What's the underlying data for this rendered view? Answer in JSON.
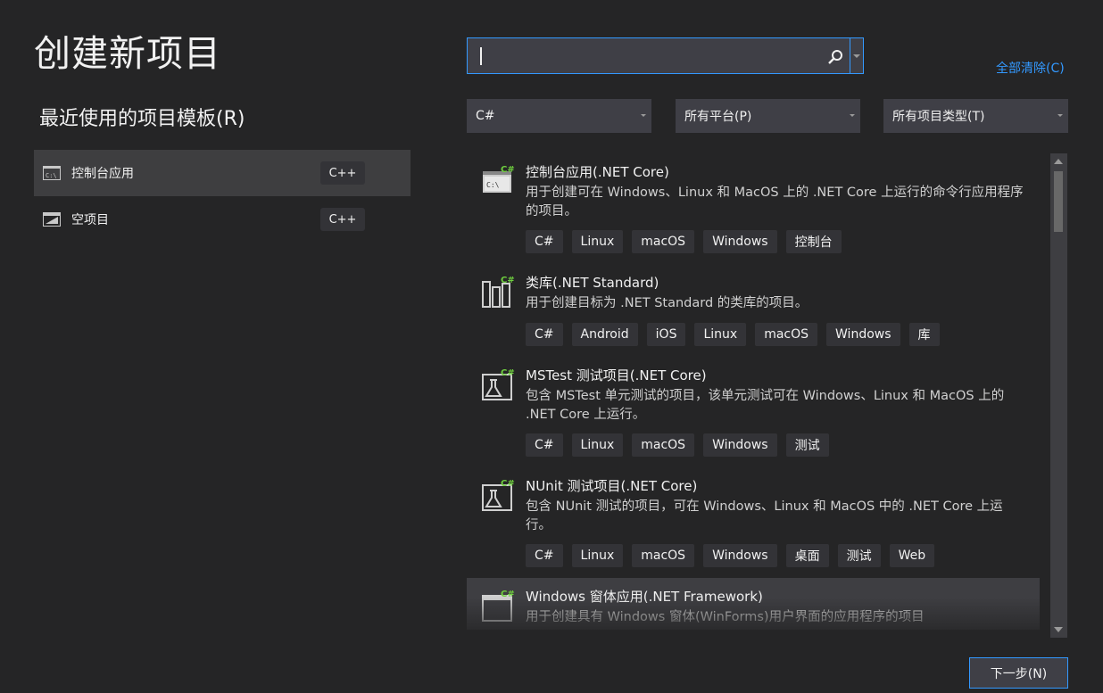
{
  "page": {
    "title": "创建新项目"
  },
  "recent": {
    "heading": "最近使用的项目模板(R)",
    "items": [
      {
        "label": "控制台应用",
        "badge": "C++",
        "icon": "console-icon"
      },
      {
        "label": "空项目",
        "badge": "C++",
        "icon": "empty-project-icon"
      }
    ]
  },
  "search": {
    "value": "",
    "placeholder": ""
  },
  "clear_all": "全部清除(C)",
  "filters": {
    "language": "C#",
    "platform": "所有平台(P)",
    "project_type": "所有项目类型(T)"
  },
  "templates": [
    {
      "name": "控制台应用(.NET Core)",
      "desc": "用于创建可在 Windows、Linux 和 MacOS 上的 .NET Core 上运行的命令行应用程序的项目。",
      "tags": [
        "C#",
        "Linux",
        "macOS",
        "Windows",
        "控制台"
      ],
      "icon": "console-app-icon"
    },
    {
      "name": "类库(.NET Standard)",
      "desc": "用于创建目标为 .NET Standard 的类库的项目。",
      "tags": [
        "C#",
        "Android",
        "iOS",
        "Linux",
        "macOS",
        "Windows",
        "库"
      ],
      "icon": "class-library-icon"
    },
    {
      "name": "MSTest 测试项目(.NET Core)",
      "desc": "包含 MSTest 单元测试的项目，该单元测试可在 Windows、Linux 和 MacOS 上的 .NET Core 上运行。",
      "tags": [
        "C#",
        "Linux",
        "macOS",
        "Windows",
        "测试"
      ],
      "icon": "test-flask-icon"
    },
    {
      "name": "NUnit 测试项目(.NET Core)",
      "desc": "包含 NUnit 测试的项目，可在 Windows、Linux 和 MacOS 中的 .NET Core 上运行。",
      "tags": [
        "C#",
        "Linux",
        "macOS",
        "Windows",
        "桌面",
        "测试",
        "Web"
      ],
      "icon": "test-flask-icon"
    },
    {
      "name": "Windows 窗体应用(.NET Framework)",
      "desc": "用于创建具有 Windows 窗体(WinForms)用户界面的应用程序的项目",
      "tags": [],
      "icon": "windows-form-icon"
    }
  ],
  "next_button": "下一步(N)",
  "colors": {
    "accent": "#3399ff",
    "bg": "#252526",
    "csharp_badge": "#6fcf3f"
  }
}
